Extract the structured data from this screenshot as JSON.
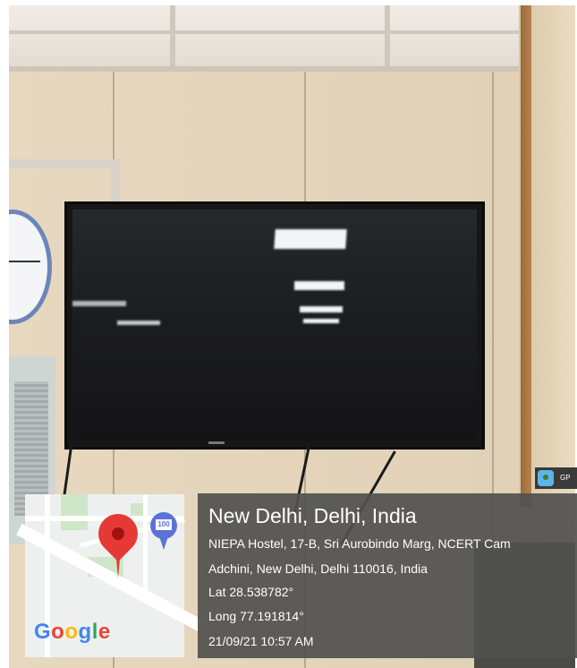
{
  "location_stamp": {
    "title": "New Delhi, Delhi, India",
    "address_line1": "NIEPA Hostel, 17-B, Sri Aurobindo Marg, NCERT Cam",
    "address_line2": "Adchini, New Delhi, Delhi 110016, India",
    "latitude": "Lat 28.538782°",
    "longitude": "Long 77.191814°",
    "timestamp": "21/09/21 10:57 AM"
  },
  "map_thumbnail": {
    "map_marker_label": "100"
  },
  "gps_badge": {
    "label": "GP"
  },
  "colors": {
    "pin": "#e53935",
    "marker": "#5b73d9",
    "overlay": "#50504e"
  }
}
